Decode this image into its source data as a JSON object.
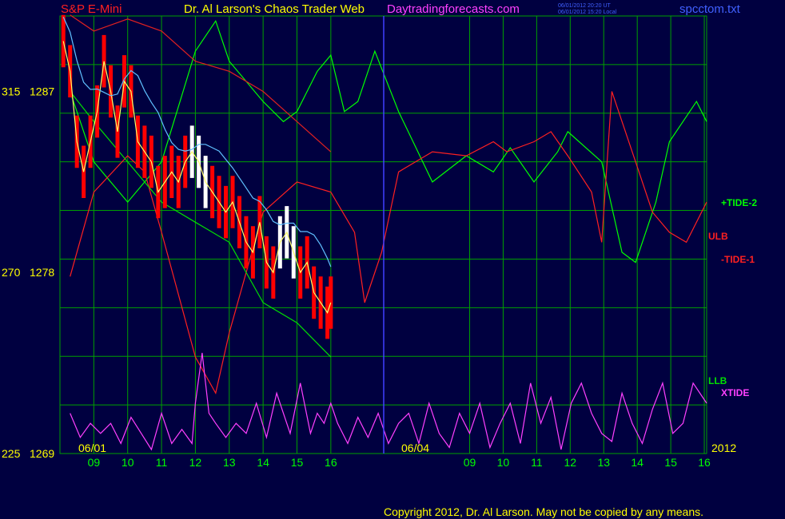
{
  "header": {
    "instrument": "S&P E-Mini",
    "title": "Dr. Al Larson's Chaos Trader Web",
    "website": "Daytradingforecasts.com",
    "stamp_ut": "06/01/2012 20:20 UT",
    "stamp_local": "06/01/2012 15:20 Local",
    "file": "spcctom.txt"
  },
  "footer": {
    "copyright": "Copyright 2012, Dr. Al Larson. May not be copied by any means."
  },
  "colors": {
    "background": "#000040",
    "grid": "#00a000",
    "axis_text": "#ffff00",
    "price_bars": "#ff0000",
    "price_recent": "#ffffff",
    "avg_fast": "#ffff66",
    "avg_slow": "#60c0ff",
    "tide_plus": "#00ff00",
    "tide_minus": "#ff2020",
    "ulb": "#e02020",
    "llb": "#00e000",
    "xtide": "#ff40ff",
    "today_marker": "#4040ff"
  },
  "chart_data": {
    "type": "line",
    "date_labels": [
      "06/01",
      "06/04",
      "2012"
    ],
    "x_hour_labels": [
      "09",
      "10",
      "11",
      "12",
      "13",
      "14",
      "15",
      "16",
      "09",
      "10",
      "11",
      "12",
      "13",
      "14",
      "15",
      "16"
    ],
    "y_labels": [
      {
        "left": "315",
        "right": "1287",
        "value": 1287
      },
      {
        "left": "270",
        "right": "1278",
        "value": 1278
      },
      {
        "left": "225",
        "right": "1269",
        "value": 1269
      }
    ],
    "ylim": [
      1269,
      1290.75
    ],
    "grid": true,
    "series": [
      {
        "name": "+TIDE-2",
        "color": "#00ff00",
        "x": [
          8.3,
          9.0,
          10.0,
          11.0,
          12.0,
          12.6,
          13.0,
          14.0,
          14.6,
          15.0,
          15.6,
          16.0,
          16.4,
          16.8,
          17.3,
          18.0,
          19.0,
          20.0,
          20.8,
          21.3,
          22.0,
          22.7,
          23.0,
          24.0,
          24.6,
          25.0,
          25.6,
          26.0,
          26.8,
          27.1
        ],
        "y": [
          1287.0,
          1283.5,
          1281.5,
          1283.5,
          1289.0,
          1290.5,
          1288.5,
          1286.5,
          1285.5,
          1286.0,
          1288.0,
          1288.8,
          1286.0,
          1286.5,
          1289.0,
          1286.0,
          1282.5,
          1283.8,
          1283.0,
          1284.2,
          1282.5,
          1284.0,
          1285.0,
          1283.5,
          1279.0,
          1278.5,
          1281.5,
          1284.5,
          1286.5,
          1285.5
        ]
      },
      {
        "name": "-TIDE-1",
        "color": "#ff2020",
        "x": [
          8.3,
          9.0,
          10.0,
          10.5,
          11.0,
          12.0,
          12.6,
          13.0,
          14.0,
          15.0,
          16.0,
          16.7,
          17.0,
          17.5,
          18.0,
          19.0,
          20.0,
          20.8,
          21.2,
          22.0,
          22.5,
          23.0,
          23.7,
          24.0,
          24.3,
          25.0,
          25.5,
          26.0,
          26.5,
          27.1
        ],
        "y": [
          1277.8,
          1282.0,
          1283.8,
          1283.0,
          1280.0,
          1273.8,
          1272.0,
          1275.0,
          1281.0,
          1282.5,
          1282.0,
          1280.0,
          1276.5,
          1279.0,
          1283.0,
          1284.0,
          1283.8,
          1284.5,
          1284.0,
          1284.5,
          1285.0,
          1283.8,
          1282.0,
          1279.5,
          1287.0,
          1283.5,
          1281.0,
          1280.0,
          1279.5,
          1281.5
        ]
      },
      {
        "name": "ULB",
        "color": "#e02020",
        "x": [
          8.3,
          9.0,
          10.0,
          11.0,
          12.0,
          13.0,
          14.0,
          15.0,
          16.0
        ],
        "y": [
          1290.8,
          1290.0,
          1290.6,
          1290.0,
          1288.5,
          1288.0,
          1287.0,
          1285.5,
          1284.0
        ]
      },
      {
        "name": "LLB",
        "color": "#00e000",
        "x": [
          8.3,
          9.0,
          10.0,
          11.0,
          12.0,
          13.0,
          14.0,
          15.0,
          16.0
        ],
        "y": [
          1287.0,
          1285.5,
          1283.5,
          1281.5,
          1280.5,
          1279.5,
          1276.5,
          1275.5,
          1273.8
        ]
      },
      {
        "name": "XTIDE",
        "color": "#ff40ff",
        "x": [
          8.3,
          8.6,
          8.9,
          9.2,
          9.5,
          9.8,
          10.1,
          10.4,
          10.7,
          11.0,
          11.3,
          11.6,
          11.9,
          12.0,
          12.2,
          12.4,
          12.6,
          12.9,
          13.2,
          13.5,
          13.8,
          14.1,
          14.4,
          14.6,
          14.8,
          15.1,
          15.4,
          15.6,
          15.8,
          16.0,
          16.2,
          16.5,
          16.8,
          17.1,
          17.4,
          17.7,
          18.0,
          18.3,
          18.6,
          18.9,
          19.2,
          19.5,
          19.8,
          20.1,
          20.4,
          20.7,
          21.0,
          21.3,
          21.6,
          21.9,
          22.2,
          22.5,
          22.8,
          23.1,
          23.4,
          23.7,
          24.0,
          24.3,
          24.6,
          24.9,
          25.2,
          25.5,
          25.8,
          26.1,
          26.4,
          26.7,
          27.1
        ],
        "y": [
          1271.0,
          1269.8,
          1270.5,
          1270.0,
          1270.5,
          1269.5,
          1270.8,
          1270.0,
          1269.2,
          1271.0,
          1269.5,
          1270.2,
          1269.5,
          1271.5,
          1274.0,
          1271.0,
          1270.5,
          1269.8,
          1270.5,
          1270.0,
          1271.5,
          1269.8,
          1272.0,
          1271.0,
          1270.0,
          1272.5,
          1270.0,
          1271.0,
          1270.5,
          1271.5,
          1270.5,
          1269.5,
          1270.8,
          1269.8,
          1271.0,
          1269.5,
          1270.5,
          1271.0,
          1269.5,
          1271.5,
          1270.0,
          1269.3,
          1271.0,
          1270.0,
          1271.5,
          1269.3,
          1270.5,
          1271.5,
          1269.5,
          1272.5,
          1270.5,
          1271.8,
          1269.2,
          1271.5,
          1272.5,
          1271.0,
          1270.0,
          1269.6,
          1272.0,
          1270.5,
          1269.5,
          1271.2,
          1272.5,
          1270.0,
          1270.5,
          1272.5,
          1271.5
        ]
      },
      {
        "name": "price",
        "color": "#ff0000",
        "x": [
          8.1,
          8.3,
          8.5,
          8.7,
          8.9,
          9.1,
          9.3,
          9.5,
          9.7,
          9.9,
          10.1,
          10.3,
          10.5,
          10.7,
          10.9,
          11.1,
          11.3,
          11.5,
          11.7,
          11.9,
          12.1,
          12.3,
          12.5,
          12.7,
          12.9,
          13.1,
          13.3,
          13.5,
          13.7,
          13.9,
          14.1,
          14.3,
          14.5,
          14.7,
          14.9,
          15.1,
          15.3,
          15.5,
          15.7,
          15.9,
          16.0
        ],
        "y": [
          1289.5,
          1288.0,
          1284.5,
          1283.0,
          1284.5,
          1286.0,
          1288.5,
          1287.0,
          1285.0,
          1287.5,
          1287.0,
          1284.5,
          1284.0,
          1283.5,
          1282.0,
          1282.5,
          1283.0,
          1282.5,
          1283.5,
          1284.0,
          1283.5,
          1282.5,
          1282.0,
          1281.5,
          1281.0,
          1281.5,
          1280.5,
          1279.5,
          1279.0,
          1280.5,
          1278.5,
          1278.0,
          1279.5,
          1280.0,
          1279.0,
          1278.0,
          1278.5,
          1277.0,
          1276.5,
          1276.0,
          1276.5
        ]
      }
    ]
  },
  "legend": {
    "tide_plus": "+TIDE-2",
    "ulb": "ULB",
    "tide_minus": "-TIDE-1",
    "llb": "LLB",
    "xtide": "XTIDE"
  }
}
